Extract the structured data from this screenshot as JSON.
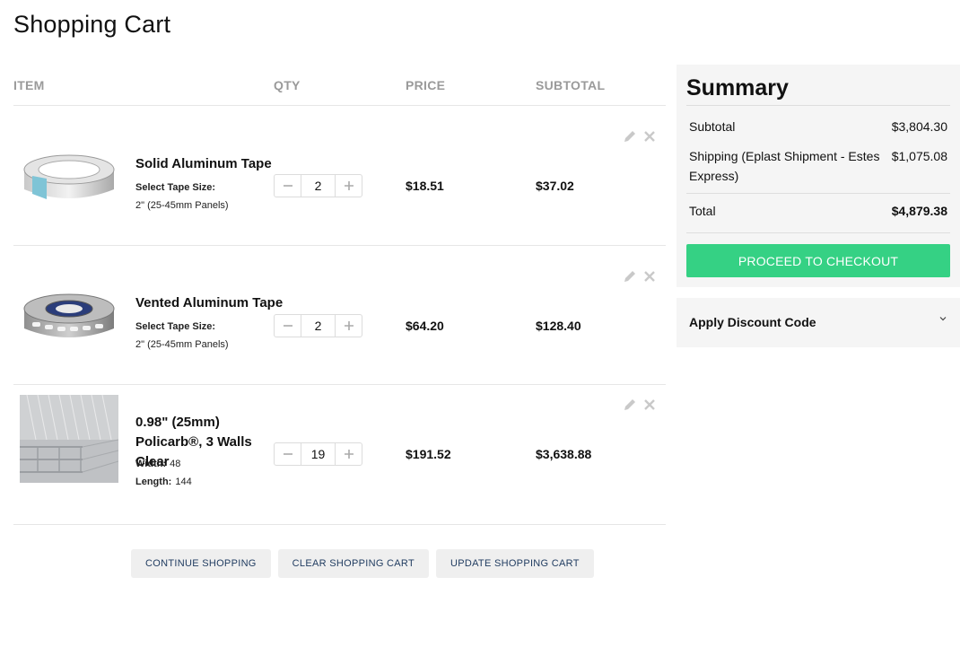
{
  "page_title": "Shopping Cart",
  "columns": {
    "item": "ITEM",
    "qty": "QTY",
    "price": "PRICE",
    "subtotal": "SUBTOTAL"
  },
  "items": [
    {
      "name": "Solid Aluminum Tape",
      "options": [
        {
          "label": "Select Tape Size:",
          "value": ""
        }
      ],
      "option_detail": "2\" (25-45mm Panels)",
      "qty": "2",
      "price": "$18.51",
      "subtotal": "$37.02",
      "image_icon": "aluminum-tape-roll"
    },
    {
      "name": "Vented Aluminum Tape",
      "options": [
        {
          "label": "Select Tape Size:",
          "value": ""
        }
      ],
      "option_detail": "2\" (25-45mm Panels)",
      "qty": "2",
      "price": "$64.20",
      "subtotal": "$128.40",
      "image_icon": "vented-tape-roll"
    },
    {
      "name": "0.98\" (25mm) Policarb®, 3 Walls Clear",
      "options": [
        {
          "label": "Width:",
          "value": "48"
        },
        {
          "label": "Length:",
          "value": "144"
        }
      ],
      "qty": "19",
      "price": "$191.52",
      "subtotal": "$3,638.88",
      "image_icon": "polycarbonate-panel"
    }
  ],
  "buttons": {
    "continue": "CONTINUE SHOPPING",
    "clear": "CLEAR SHOPPING CART",
    "update": "UPDATE SHOPPING CART"
  },
  "summary": {
    "title": "Summary",
    "subtotal_label": "Subtotal",
    "subtotal_value": "$3,804.30",
    "shipping_label": "Shipping (Eplast Shipment - Estes Express)",
    "shipping_value": "$1,075.08",
    "total_label": "Total",
    "total_value": "$4,879.38",
    "checkout_label": "PROCEED TO CHECKOUT"
  },
  "discount": {
    "label": "Apply Discount Code"
  },
  "colors": {
    "checkout": "#35d184",
    "panel_bg": "#f5f5f5",
    "button_text": "#1e3a5f"
  },
  "icons": [
    "pencil-icon",
    "close-icon",
    "minus-icon",
    "plus-icon",
    "chevron-down-icon"
  ]
}
